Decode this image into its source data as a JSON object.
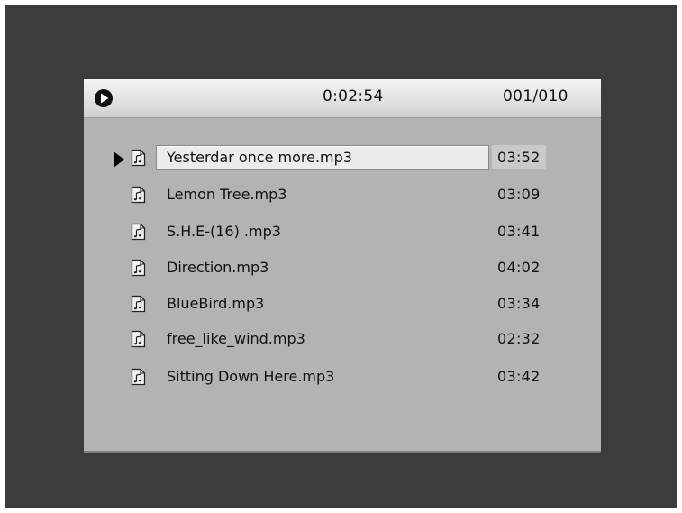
{
  "player": {
    "elapsed_time": "0:02:54",
    "track_counter": "001/010",
    "selected_index": 0
  },
  "tracks": [
    {
      "name": "Yesterdar once more.mp3",
      "duration": "03:52"
    },
    {
      "name": "Lemon Tree.mp3",
      "duration": "03:09"
    },
    {
      "name": "S.H.E-(16) .mp3",
      "duration": "03:41"
    },
    {
      "name": "Direction.mp3",
      "duration": "04:02"
    },
    {
      "name": "BlueBird.mp3",
      "duration": "03:34"
    },
    {
      "name": "free_like_wind.mp3",
      "duration": "02:32"
    },
    {
      "name": "Sitting Down Here.mp3",
      "duration": "03:42"
    }
  ],
  "icons": {
    "play": "play-circle-icon",
    "file": "music-file-icon",
    "cursor": "selection-arrow-icon"
  },
  "colors": {
    "background": "#3c3c3c",
    "panel": "#b3b3b3",
    "highlight": "#ececec"
  }
}
